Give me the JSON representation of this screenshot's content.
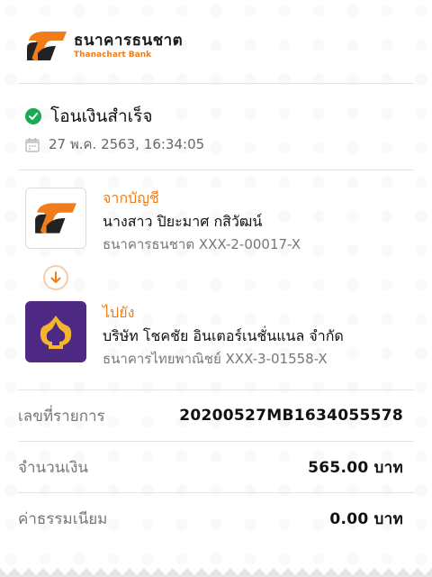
{
  "bank": {
    "name_th": "ธนาคารธนชาต",
    "name_en": "Thanachart Bank",
    "brand_color": "#f07c1a"
  },
  "status": {
    "text": "โอนเงินสำเร็จ",
    "icon": "check-circle-icon",
    "color": "#1aa954"
  },
  "datetime": {
    "text": "27 พ.ค. 2563, 16:34:05",
    "icon": "calendar-icon"
  },
  "from_account": {
    "label": "จากบัญชี",
    "name": "นางสาว ปิยะมาศ กสิวัฒน์",
    "detail": "ธนาคารธนชาต XXX-2-00017-X"
  },
  "to_account": {
    "label": "ไปยัง",
    "name": "บริษัท โชคชัย อินเตอร์เนชั่นแนล จำกัด",
    "detail": "ธนาคารไทยพาณิชย์ XXX-3-01558-X",
    "bank_color": "#4e2a84"
  },
  "details": {
    "ref_label": "เลขที่รายการ",
    "ref_value": "20200527MB1634055578",
    "amount_label": "จำนวนเงิน",
    "amount_value": "565.00",
    "fee_label": "ค่าธรรมเนียม",
    "fee_value": "0.00",
    "currency": "บาท"
  }
}
